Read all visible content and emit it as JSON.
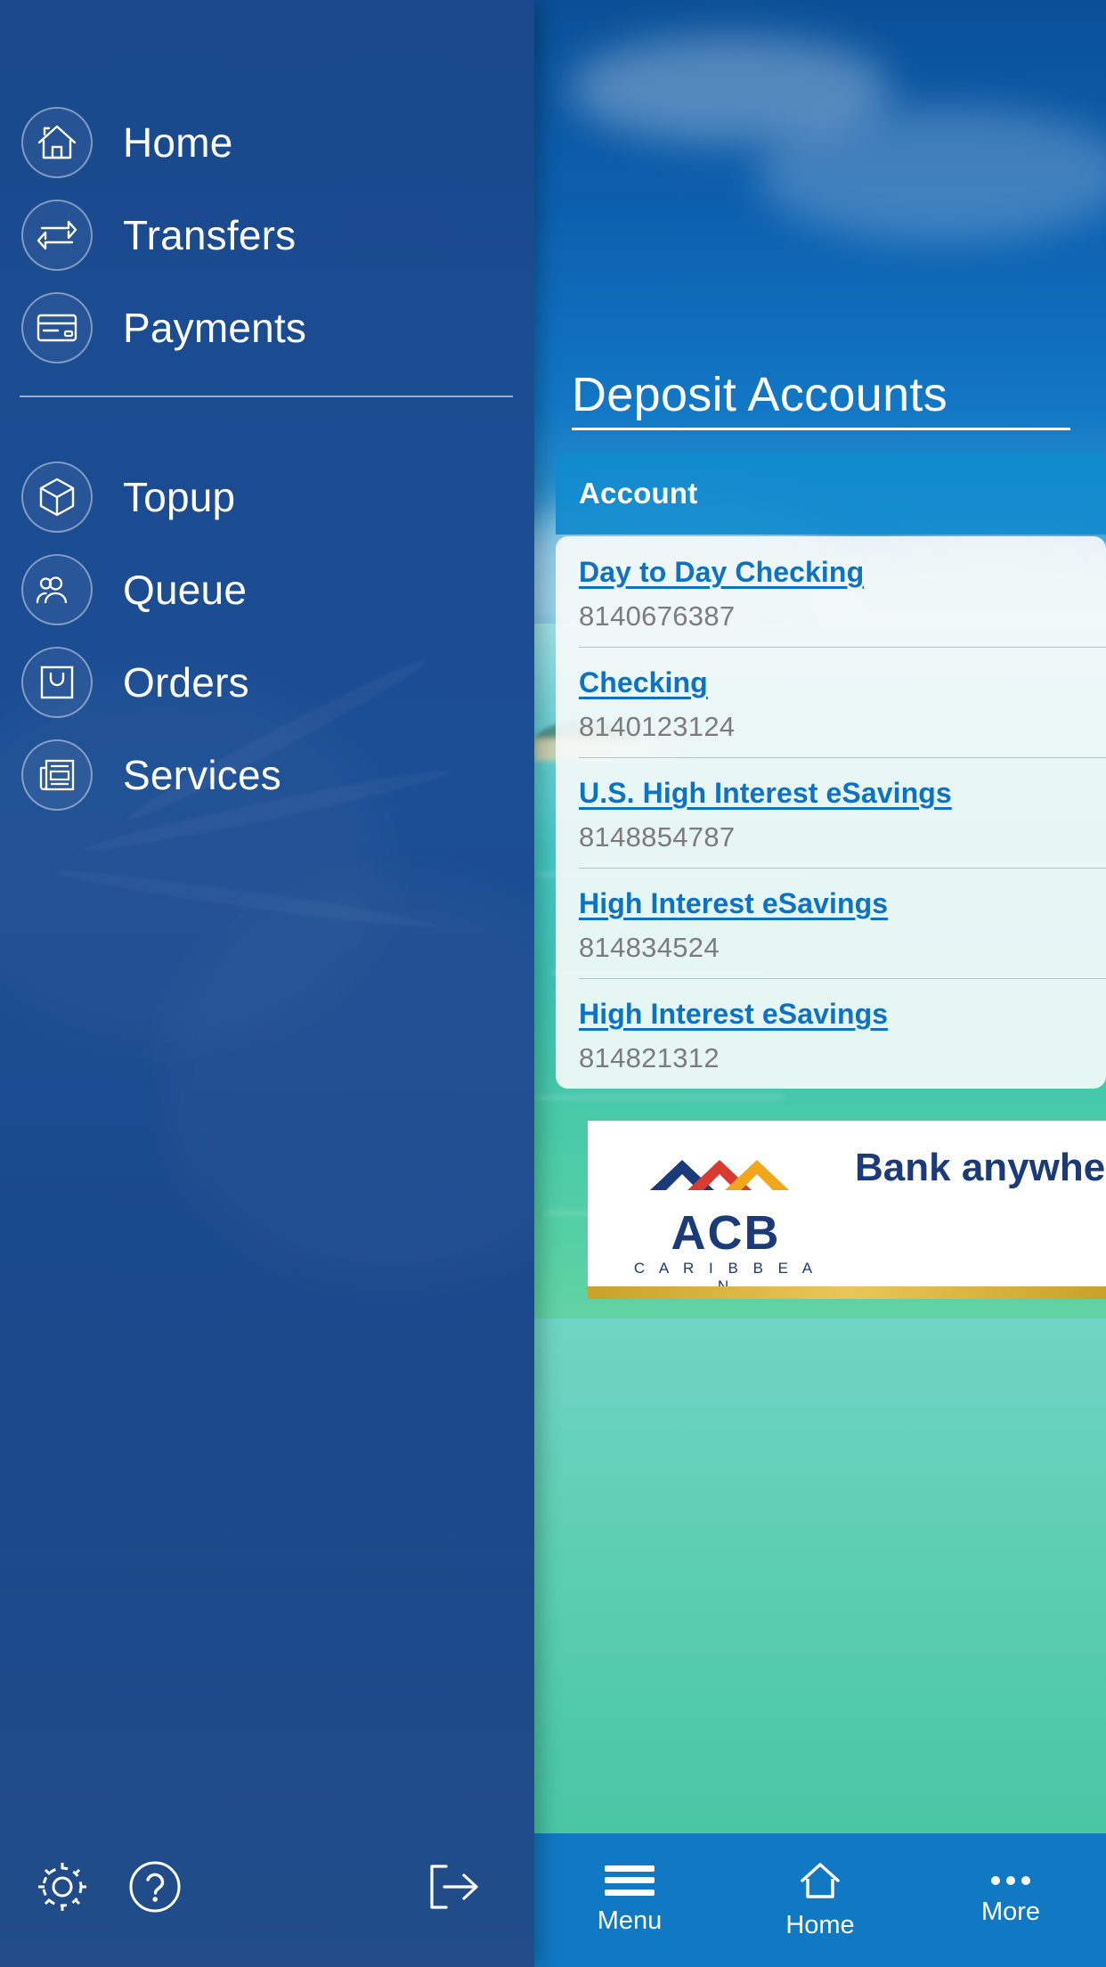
{
  "drawer": {
    "primary_items": [
      {
        "label": "Home",
        "icon": "home-icon"
      },
      {
        "label": "Transfers",
        "icon": "transfers-icon"
      },
      {
        "label": "Payments",
        "icon": "credit-card-icon"
      }
    ],
    "secondary_items": [
      {
        "label": "Topup",
        "icon": "cube-icon"
      },
      {
        "label": "Queue",
        "icon": "people-icon"
      },
      {
        "label": "Orders",
        "icon": "shopping-bag-icon"
      },
      {
        "label": "Services",
        "icon": "newspaper-icon"
      }
    ],
    "footer": [
      {
        "name": "settings-button",
        "icon": "gear-icon"
      },
      {
        "name": "help-button",
        "icon": "question-mark-icon"
      },
      {
        "name": "logout-button",
        "icon": "logout-arrow-icon"
      }
    ]
  },
  "screen": {
    "title": "Deposit Accounts",
    "account_header": "Account",
    "accounts": [
      {
        "name": "Day to Day Checking",
        "number": "8140676387"
      },
      {
        "name": "Checking",
        "number": "8140123124"
      },
      {
        "name": "U.S. High Interest eSavings",
        "number": "8148854787"
      },
      {
        "name": "High Interest eSavings",
        "number": "814834524"
      },
      {
        "name": "High Interest eSavings",
        "number": "814821312"
      }
    ],
    "promo": {
      "logo_word": "ACB",
      "logo_sub": "C A R I B B E A N",
      "headline": "Bank anywhere,\nanytime"
    },
    "bottom_nav": [
      {
        "label": "Menu",
        "icon": "hamburger-icon"
      },
      {
        "label": "Home",
        "icon": "home-icon"
      },
      {
        "label": "More",
        "icon": "dots-icon"
      }
    ]
  },
  "colors": {
    "drawer_blue": "#1a498d",
    "brand_blue": "#1178c4",
    "link_blue": "#0d72c4",
    "account_number_gray": "#7c7c7c",
    "logo_navy": "#1b3a7a",
    "gold": "#c9a227"
  }
}
